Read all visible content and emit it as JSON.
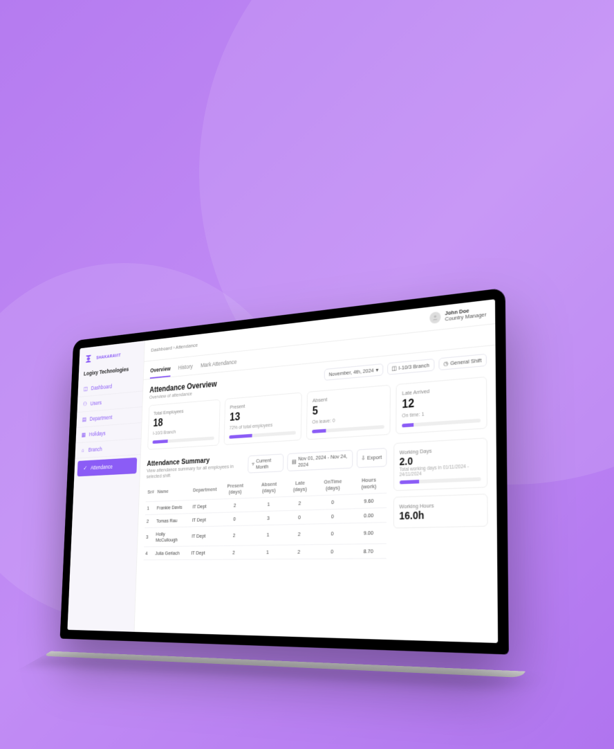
{
  "brand": {
    "name": "SHAKARAVIT"
  },
  "company": "Logixy Technologies",
  "sidebar": {
    "items": [
      {
        "label": "Dashboard",
        "icon": "dashboard-icon"
      },
      {
        "label": "Users",
        "icon": "users-icon"
      },
      {
        "label": "Department",
        "icon": "department-icon"
      },
      {
        "label": "Holidays",
        "icon": "calendar-icon"
      },
      {
        "label": "Branch",
        "icon": "branch-icon"
      },
      {
        "label": "Attendance",
        "icon": "attendance-icon"
      }
    ],
    "activeIndex": 5
  },
  "breadcrumbs": [
    "Dashboard",
    "Attendance"
  ],
  "user": {
    "name": "John Doe",
    "role": "Country Manager"
  },
  "tabs": {
    "items": [
      "Overview",
      "History",
      "Mark Attendance"
    ],
    "activeIndex": 0
  },
  "overview": {
    "title": "Attendance Overview",
    "subtitle": "Overview of attendance",
    "filters": {
      "date": "November, 4th, 2024",
      "branch": "I-10/3 Branch",
      "shift": "General Shift"
    },
    "cards": [
      {
        "label": "Total Employees",
        "value": "18",
        "sub": "I-10/3 Branch",
        "pct": 25
      },
      {
        "label": "Present",
        "value": "13",
        "sub": "72% of total employees",
        "pct": 35
      },
      {
        "label": "Absent",
        "value": "5",
        "sub": "On leave: 0",
        "pct": 20
      },
      {
        "label": "Late Arrived",
        "value": "12",
        "sub": "On time: 1",
        "pct": 15
      }
    ]
  },
  "summary": {
    "title": "Attendance Summary",
    "subtitle": "View attendance summary for all employees in selected shift",
    "filters": {
      "period": "Current Month",
      "range": "Nov 01, 2024 - Nov 24, 2024",
      "export": "Export"
    },
    "columns": [
      "Sr#",
      "Name",
      "Department",
      "Present (days)",
      "Absent (days)",
      "Late (days)",
      "OnTime (days)",
      "Hours (work)"
    ],
    "rows": [
      {
        "sr": "1",
        "name": "Frankie Davis",
        "dept": "IT Dept",
        "present": "2",
        "absent": "1",
        "late": "2",
        "ontime": "0",
        "hours": "9.60"
      },
      {
        "sr": "2",
        "name": "Tomas Rau",
        "dept": "IT Dept",
        "present": "0",
        "absent": "3",
        "late": "0",
        "ontime": "0",
        "hours": "0.00"
      },
      {
        "sr": "3",
        "name": "Holly McCullough",
        "dept": "IT Dept",
        "present": "2",
        "absent": "1",
        "late": "2",
        "ontime": "0",
        "hours": "9.00"
      },
      {
        "sr": "4",
        "name": "Julia Gerlach",
        "dept": "IT Dept",
        "present": "2",
        "absent": "1",
        "late": "2",
        "ontime": "0",
        "hours": "8.70"
      }
    ],
    "sideCards": [
      {
        "label": "Working Days",
        "value": "2.0",
        "sub": "Total working days in 01/11/2024 - 24/11/2024",
        "pct": 25
      },
      {
        "label": "Working Hours",
        "value": "16.0h",
        "sub": "",
        "pct": 0
      }
    ]
  },
  "colors": {
    "accent": "#8b5cf6"
  }
}
